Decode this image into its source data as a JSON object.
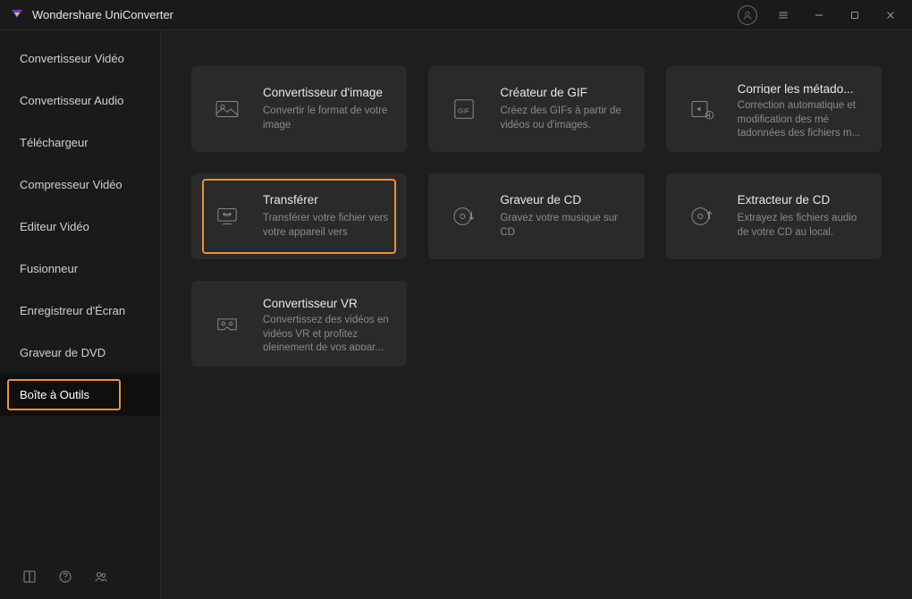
{
  "app": {
    "title": "Wondershare UniConverter"
  },
  "sidebar": {
    "items": [
      {
        "label": "Convertisseur Vidéo"
      },
      {
        "label": "Convertisseur Audio"
      },
      {
        "label": "Téléchargeur"
      },
      {
        "label": "Compresseur Vidéo"
      },
      {
        "label": "Editeur Vidéo"
      },
      {
        "label": "Fusionneur"
      },
      {
        "label": "Enregistreur d'Écran"
      },
      {
        "label": "Graveur de DVD"
      },
      {
        "label": "Boîte à Outils"
      }
    ]
  },
  "cards": [
    {
      "title": "Convertisseur d'image",
      "desc": "Convertir le format de votre image"
    },
    {
      "title": "Créateur de GIF",
      "desc": "Créez des GIFs à partir de vidéos ou d'images."
    },
    {
      "title": "Corriger les métado...",
      "desc": "Correction automatique et modification des mé tadonnées des fichiers m..."
    },
    {
      "title": "Transférer",
      "desc": "Transférer votre fichier vers votre appareil vers"
    },
    {
      "title": "Graveur de CD",
      "desc": "Gravez votre musique sur CD"
    },
    {
      "title": "Extracteur de CD",
      "desc": "Extrayez les fichiers audio de votre CD au local."
    },
    {
      "title": "Convertisseur VR",
      "desc": "Convertissez des vidéos en vidéos VR et profitez pleinement de vos appar..."
    }
  ]
}
